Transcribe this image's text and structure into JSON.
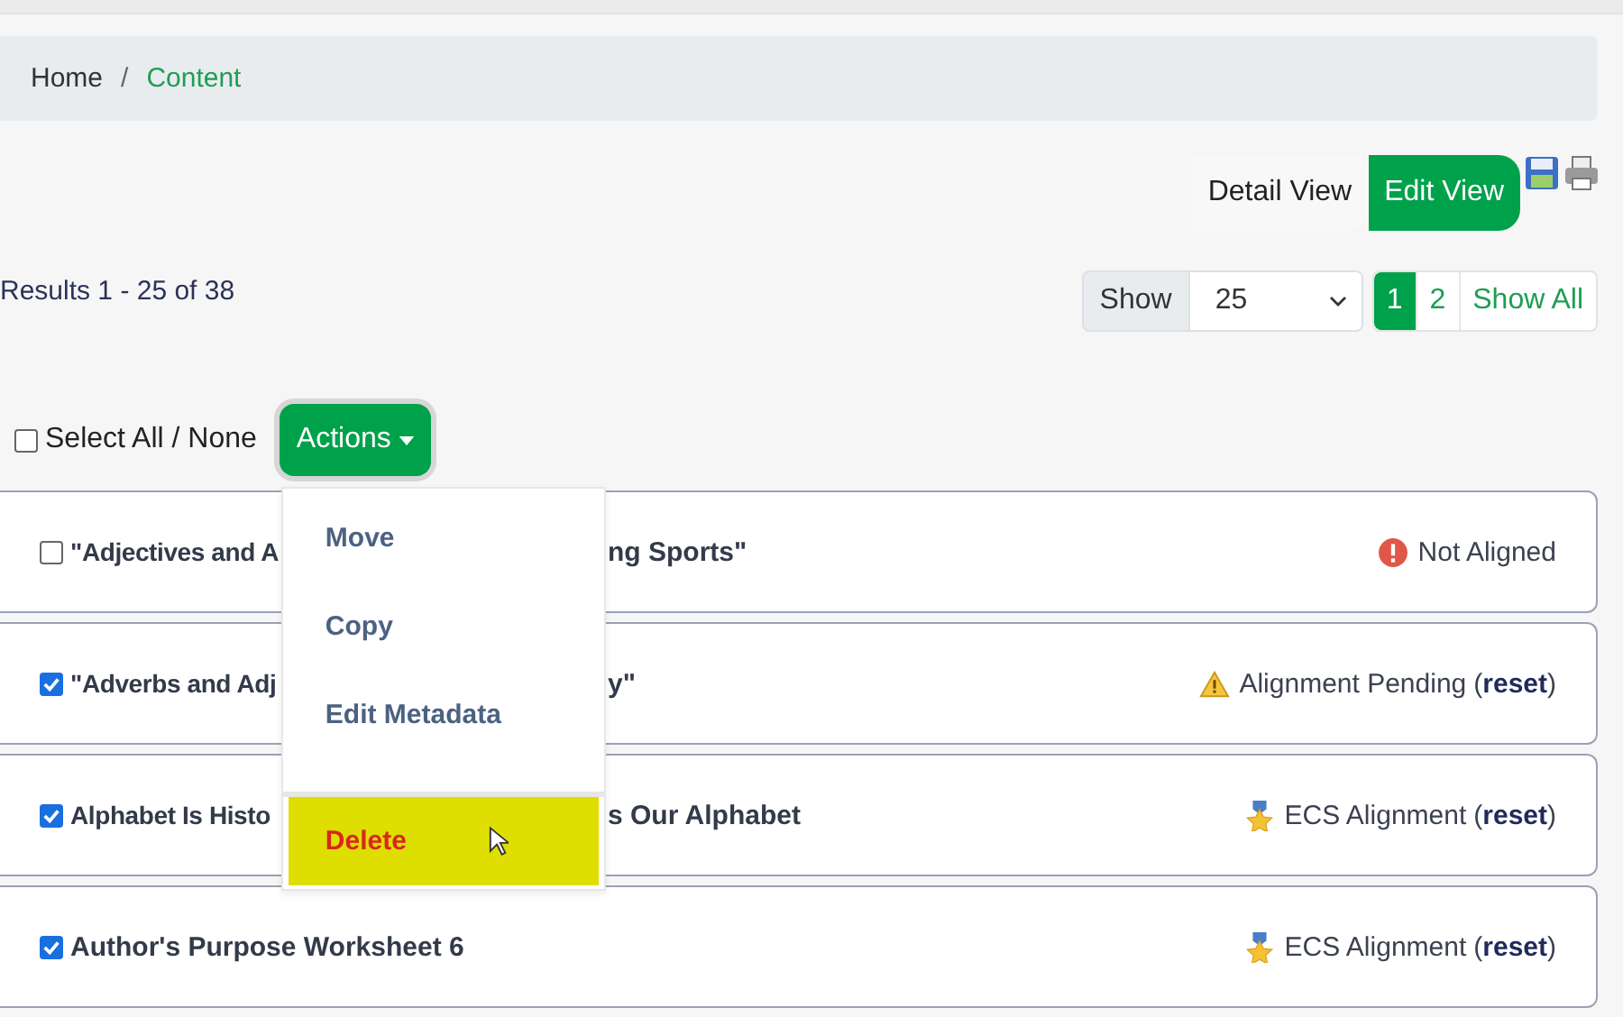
{
  "breadcrumb_separator": "/",
  "breadcrumb": [
    {
      "label": "Home",
      "current": false
    },
    {
      "label": "Content",
      "current": true
    }
  ],
  "views": [
    {
      "label": "Detail View",
      "selected": false
    },
    {
      "label": "Edit View",
      "selected": true
    }
  ],
  "results": "Results 1 - 25 of 38",
  "pager": {
    "show_label": "Show",
    "per_page": "25",
    "pages": [
      {
        "label": "1",
        "selected": true
      },
      {
        "label": "2",
        "selected": false
      },
      {
        "label": "Show All",
        "selected": false
      }
    ]
  },
  "select_all": {
    "label": "Select All / None",
    "checked": false
  },
  "actions": {
    "label": "Actions",
    "expanded": true,
    "items": [
      {
        "label": "Move",
        "kind": "normal",
        "hovered": false
      },
      {
        "label": "Copy",
        "kind": "normal",
        "hovered": false
      },
      {
        "label": "Edit Metadata",
        "kind": "normal",
        "hovered": false
      },
      {
        "label": "Delete",
        "kind": "danger",
        "hovered": true
      }
    ]
  },
  "rows": [
    {
      "checked": false,
      "title_start": "\"Adjectives and A",
      "title_end": "ng Sports\"",
      "status": {
        "kind": "error",
        "label": "Not Aligned"
      }
    },
    {
      "checked": true,
      "title_start": "\"Adverbs and Adj",
      "title_end": "y\"",
      "status": {
        "kind": "warning",
        "label": "Alignment Pending",
        "paren_open": "(",
        "reset": "reset",
        "paren_close": ")"
      }
    },
    {
      "checked": true,
      "title_start": "Alphabet Is Histo",
      "title_end": "s Our Alphabet",
      "status": {
        "kind": "award",
        "label": "ECS Alignment",
        "paren_open": "(",
        "reset": "reset",
        "paren_close": ")"
      }
    },
    {
      "checked": true,
      "title_start": "Author's Purpose Worksheet 6",
      "status": {
        "kind": "award",
        "label": "ECS Alignment",
        "paren_open": "(",
        "reset": "reset",
        "paren_close": ")"
      }
    }
  ]
}
